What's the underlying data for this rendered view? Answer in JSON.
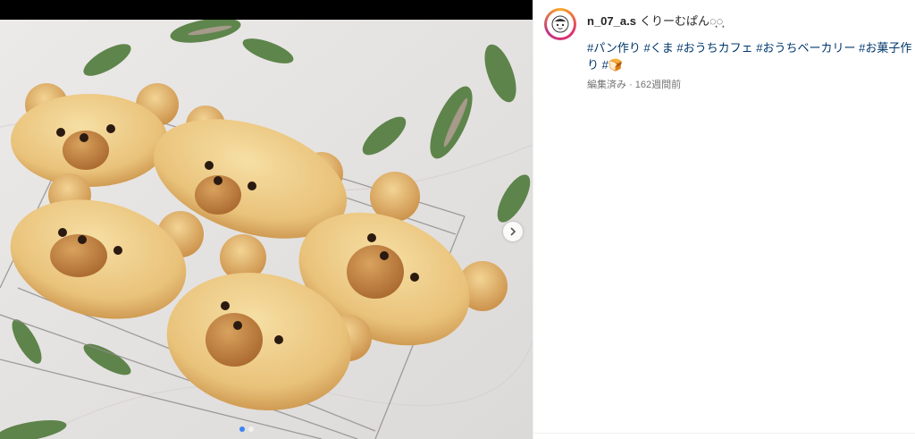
{
  "post": {
    "username": "n_07_a.s",
    "caption": "くりーむぱん◌͙◌͙",
    "hashtags": [
      "#パン作り",
      "#くま",
      "#おうちカフェ",
      "#おうちベーカリー",
      "#お菓子作り",
      "#🍞"
    ],
    "edited_label": "編集済み",
    "separator": "·",
    "time_ago": "162週間前"
  },
  "carousel": {
    "current_index": 1,
    "total": 2
  },
  "colors": {
    "hashtag": "#00376b",
    "dot_active": "#3b82f6",
    "text": "#262626",
    "meta": "#737373"
  },
  "icons": {
    "next": "chevron-right-icon",
    "avatar": "profile-avatar"
  }
}
